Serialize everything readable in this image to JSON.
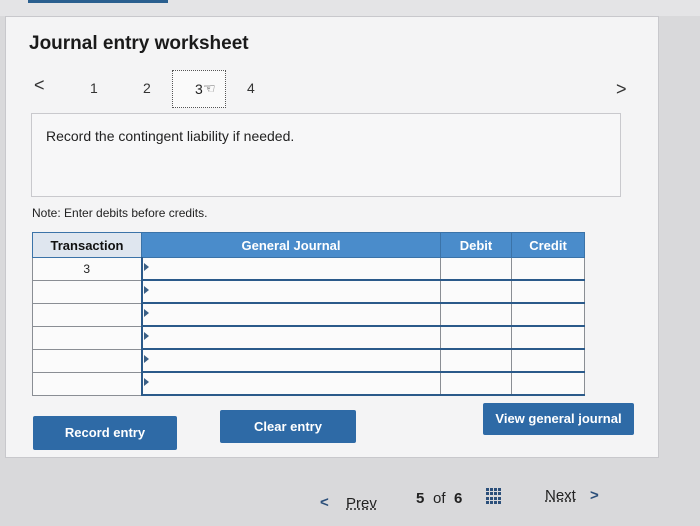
{
  "title": "Journal entry worksheet",
  "steps": {
    "prev_arrow": "<",
    "next_arrow": ">",
    "items": [
      "1",
      "2",
      "3",
      "4"
    ]
  },
  "prompt": "Record the contingent liability if needed.",
  "note": "Note: Enter debits before credits.",
  "table": {
    "headers": {
      "transaction": "Transaction",
      "account": "General Journal",
      "debit": "Debit",
      "credit": "Credit"
    },
    "rows": [
      {
        "transaction": "3",
        "account": "",
        "debit": "",
        "credit": ""
      },
      {
        "transaction": "",
        "account": "",
        "debit": "",
        "credit": ""
      },
      {
        "transaction": "",
        "account": "",
        "debit": "",
        "credit": ""
      },
      {
        "transaction": "",
        "account": "",
        "debit": "",
        "credit": ""
      },
      {
        "transaction": "",
        "account": "",
        "debit": "",
        "credit": ""
      },
      {
        "transaction": "",
        "account": "",
        "debit": "",
        "credit": ""
      }
    ]
  },
  "buttons": {
    "record": "Record entry",
    "clear": "Clear entry",
    "view": "View general journal"
  },
  "footer": {
    "prev_arrow": "<",
    "prev": "Prev",
    "page_current": "5",
    "page_of": "of",
    "page_total": "6",
    "next": "Next",
    "next_arrow": ">"
  },
  "colors": {
    "accent": "#2e6aa6",
    "header_blue": "#4a8ccb"
  }
}
